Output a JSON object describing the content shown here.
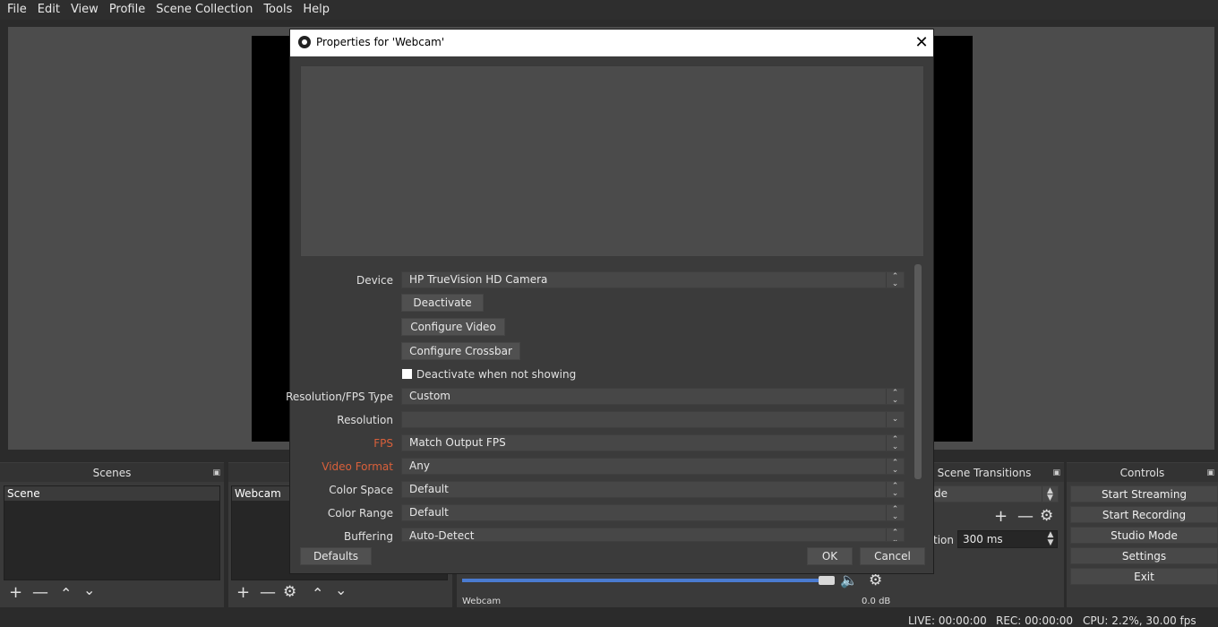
{
  "menu": [
    "File",
    "Edit",
    "View",
    "Profile",
    "Scene Collection",
    "Tools",
    "Help"
  ],
  "docks": {
    "scenes": {
      "title": "Scenes",
      "items": [
        "Scene"
      ]
    },
    "sources": {
      "items": [
        "Webcam"
      ]
    },
    "mixer": {
      "source": "Webcam",
      "level": "0.0 dB"
    },
    "transitions": {
      "title": "Scene Transitions",
      "selected": "de",
      "duration_label": "tion",
      "duration": "300 ms"
    },
    "controls": {
      "title": "Controls",
      "buttons": [
        "Start Streaming",
        "Start Recording",
        "Studio Mode",
        "Settings",
        "Exit"
      ]
    }
  },
  "status": {
    "live": "LIVE: 00:00:00",
    "rec": "REC: 00:00:00",
    "cpu": "CPU: 2.2%, 30.00 fps"
  },
  "dialog": {
    "title": "Properties for 'Webcam'",
    "properties": {
      "device_label": "Device",
      "device_value": "HP TrueVision HD Camera",
      "deactivate": "Deactivate",
      "configure_video": "Configure Video",
      "configure_crossbar": "Configure Crossbar",
      "deactivate_when_not_showing": "Deactivate when not showing",
      "res_fps_type_label": "Resolution/FPS Type",
      "res_fps_type_value": "Custom",
      "resolution_label": "Resolution",
      "resolution_value": "",
      "fps_label": "FPS",
      "fps_value": "Match Output FPS",
      "video_format_label": "Video Format",
      "video_format_value": "Any",
      "color_space_label": "Color Space",
      "color_space_value": "Default",
      "color_range_label": "Color Range",
      "color_range_value": "Default",
      "buffering_label": "Buffering",
      "buffering_value": "Auto-Detect"
    },
    "buttons": {
      "defaults": "Defaults",
      "ok": "OK",
      "cancel": "Cancel"
    }
  }
}
